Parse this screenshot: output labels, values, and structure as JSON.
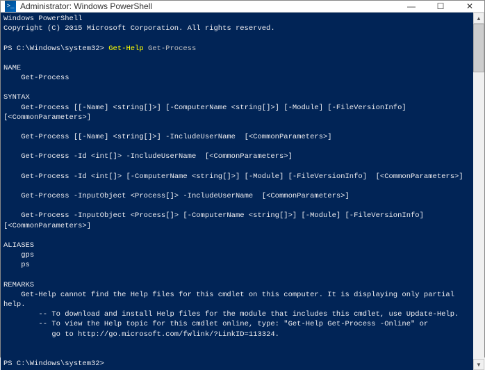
{
  "titlebar": {
    "icon_label": ">_",
    "title": "Administrator: Windows PowerShell",
    "min": "—",
    "max": "☐",
    "close": "✕"
  },
  "terminal": {
    "header1": "Windows PowerShell",
    "header2": "Copyright (C) 2015 Microsoft Corporation. All rights reserved.",
    "prompt1_prefix": "PS C:\\Windows\\system32> ",
    "prompt1_cmd": "Get-Help",
    "prompt1_arg": " Get-Process",
    "section_name_label": "NAME",
    "section_name_value": "    Get-Process",
    "section_syntax_label": "SYNTAX",
    "syntax1": "    Get-Process [[-Name] <string[]>] [-ComputerName <string[]>] [-Module] [-FileVersionInfo]  [<CommonParameters>]",
    "syntax2": "    Get-Process [[-Name] <string[]>] -IncludeUserName  [<CommonParameters>]",
    "syntax3": "    Get-Process -Id <int[]> -IncludeUserName  [<CommonParameters>]",
    "syntax4": "    Get-Process -Id <int[]> [-ComputerName <string[]>] [-Module] [-FileVersionInfo]  [<CommonParameters>]",
    "syntax5": "    Get-Process -InputObject <Process[]> -IncludeUserName  [<CommonParameters>]",
    "syntax6": "    Get-Process -InputObject <Process[]> [-ComputerName <string[]>] [-Module] [-FileVersionInfo]  [<CommonParameters>]",
    "section_aliases_label": "ALIASES",
    "alias1": "    gps",
    "alias2": "    ps",
    "section_remarks_label": "REMARKS",
    "remarks1": "    Get-Help cannot find the Help files for this cmdlet on this computer. It is displaying only partial help.",
    "remarks2": "        -- To download and install Help files for the module that includes this cmdlet, use Update-Help.",
    "remarks3": "        -- To view the Help topic for this cmdlet online, type: \"Get-Help Get-Process -Online\" or",
    "remarks4": "           go to http://go.microsoft.com/fwlink/?LinkID=113324.",
    "prompt2": "PS C:\\Windows\\system32>"
  },
  "scrollbar": {
    "up": "▲",
    "down": "▼"
  }
}
